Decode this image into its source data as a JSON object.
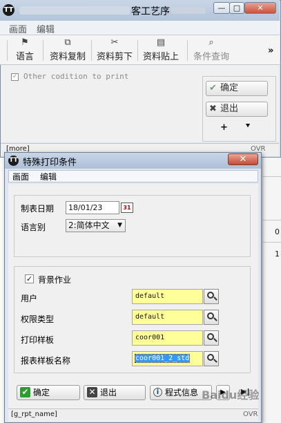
{
  "colors": {
    "field_bg": "#ffff99",
    "title_bar": "#b3c4da",
    "close_red": "#c44b33"
  },
  "background_window": {
    "title": "客工艺序",
    "window_buttons": [
      "—",
      "□",
      "✕"
    ],
    "menu": [
      "画面",
      "编辑"
    ],
    "toolbar": [
      {
        "label": "语言",
        "icon": "flag-icon"
      },
      {
        "label": "资料复制",
        "icon": "copy-icon"
      },
      {
        "label": "资料剪下",
        "icon": "scissors-icon"
      },
      {
        "label": "资料贴上",
        "icon": "paste-icon"
      },
      {
        "label": "条件查询",
        "icon": "query-icon"
      }
    ],
    "toolbar_more": "»",
    "other_condition_label": "Other codition to print",
    "confirm_label": "确定",
    "exit_label": "退出",
    "plus_glyph": "+",
    "bottom_glyph": "⯆",
    "status_left": "[more]",
    "status_right": "OVR"
  },
  "dialog": {
    "title": "特殊打印条件",
    "close_glyph": "✕",
    "menu": [
      "画面",
      "编辑"
    ],
    "report_date_label": "制表日期",
    "report_date_value": "18/01/23",
    "language_label": "语言别",
    "language_value": "2:简体中文",
    "background_job_label": "背景作业",
    "fields": [
      {
        "label": "用户",
        "value": "default"
      },
      {
        "label": "权限类型",
        "value": "default"
      },
      {
        "label": "打印样板",
        "value": "coor001"
      },
      {
        "label": "报表样板名称",
        "value": "coor001_2_std"
      }
    ],
    "ok_label": "确定",
    "exit_label": "退出",
    "program_info_label": "程式信息",
    "status_left": "[g_rpt_name]",
    "status_right": "OVR"
  },
  "side_values": [
    "0",
    "1"
  ],
  "watermark": "Baidu经验"
}
